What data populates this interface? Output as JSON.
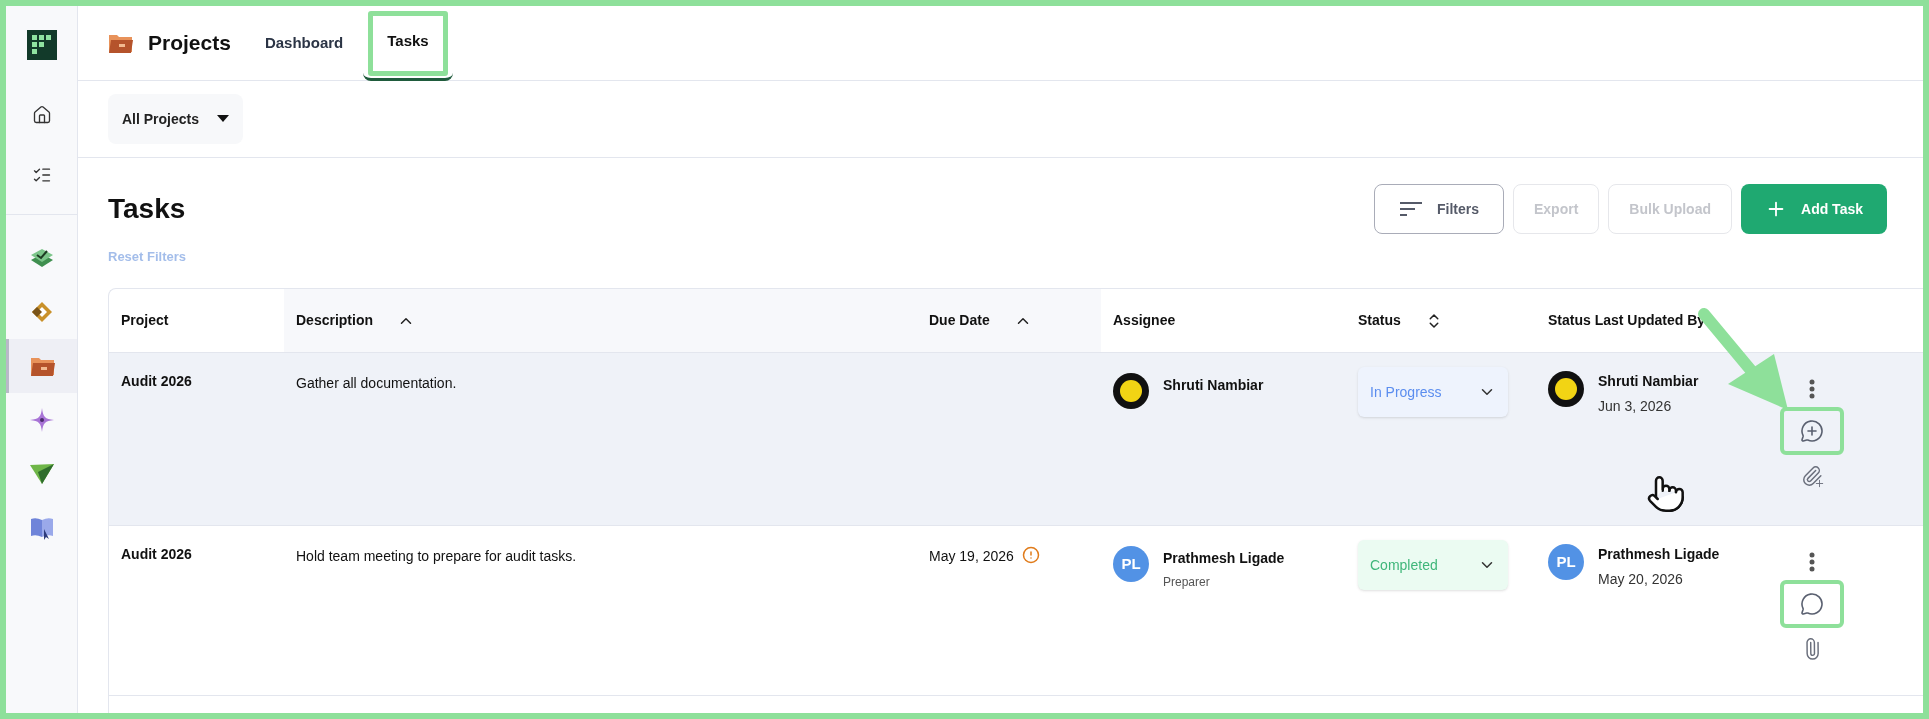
{
  "sidebar": {
    "top": [
      {
        "kind": "home",
        "selected": false
      },
      {
        "kind": "checklist",
        "selected": false
      }
    ],
    "apps": [
      {
        "kind": "stack",
        "selected": false
      },
      {
        "kind": "rings",
        "selected": false
      },
      {
        "kind": "folder",
        "selected": true
      },
      {
        "kind": "sparkle",
        "selected": false
      },
      {
        "kind": "plane",
        "selected": false
      },
      {
        "kind": "book",
        "selected": false
      }
    ]
  },
  "header": {
    "title": "Projects",
    "tabs": [
      {
        "label": "Dashboard",
        "selected": false,
        "callout": false
      },
      {
        "label": "Tasks",
        "selected": true,
        "callout": true
      }
    ]
  },
  "project_filter": {
    "value": "All Projects"
  },
  "page_title": "Tasks",
  "toolbar": [
    {
      "kind": "filter",
      "label": "Filters",
      "disabled": false
    },
    {
      "kind": "plain",
      "label": "Export",
      "disabled": true
    },
    {
      "kind": "plain",
      "label": "Bulk Upload",
      "disabled": true
    },
    {
      "kind": "add",
      "label": "Add Task",
      "disabled": false
    }
  ],
  "reset_filters": {
    "label": "Reset Filters",
    "disabled": true
  },
  "table": {
    "columns": [
      {
        "label": "Project",
        "kind": "plain"
      },
      {
        "label": "Description",
        "kind": "sorted"
      },
      {
        "label": "Due Date",
        "kind": "sorted"
      },
      {
        "label": "Assignee",
        "kind": "plain"
      },
      {
        "label": "Status",
        "kind": "sortable"
      },
      {
        "label": "Status Last Updated By",
        "kind": "plain"
      }
    ],
    "rows": [
      {
        "hovered": true,
        "project": "Audit 2026",
        "description": "Gather all documentation.",
        "assignee": {
          "name": "Shruti Nambiar"
        },
        "status": {
          "kind": "in_progress",
          "label": "In Progress"
        },
        "updated_by": {
          "name": "Shruti Nambiar",
          "date": "Jun 3, 2026"
        },
        "has_comments": false,
        "has_attachments": false,
        "callout": true
      },
      {
        "hovered": false,
        "project": "Audit 2026",
        "description": "Hold team meeting to prepare for audit tasks.",
        "due_date": "May 19, 2026",
        "overdue_warning": true,
        "assignee": {
          "avatar": {
            "kind": "initials",
            "text": "PL"
          },
          "name": "Prathmesh Ligade",
          "role": "Preparer"
        },
        "status": {
          "kind": "completed",
          "label": "Completed"
        },
        "updated_by": {
          "avatar": {
            "kind": "initials",
            "text": "PL"
          },
          "name": "Prathmesh Ligade",
          "date": "May 20, 2026"
        },
        "has_comments": true,
        "has_attachments": true,
        "callout": true
      }
    ]
  },
  "annotation": {
    "arrow": true,
    "pointer_cursor": true
  }
}
